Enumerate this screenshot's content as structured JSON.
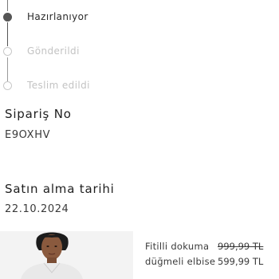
{
  "timeline": {
    "steps": [
      {
        "label": "Hazırlanıyor",
        "state": "active"
      },
      {
        "label": "Gönderildi",
        "state": "pending"
      },
      {
        "label": "Teslim edildi",
        "state": "pending"
      }
    ]
  },
  "order": {
    "number_label": "Sipariş No",
    "number_value": "E9OXHV",
    "date_label": "Satın alma tarihi",
    "date_value": "22.10.2024"
  },
  "product": {
    "name": "Fitilli dokuma düğmeli elbise",
    "old_price": "999,99 TL",
    "new_price": "599,99 TL"
  },
  "colors": {
    "active": "#555555",
    "pending": "#c3c3c3",
    "image_bg": "#f3f3f3"
  }
}
